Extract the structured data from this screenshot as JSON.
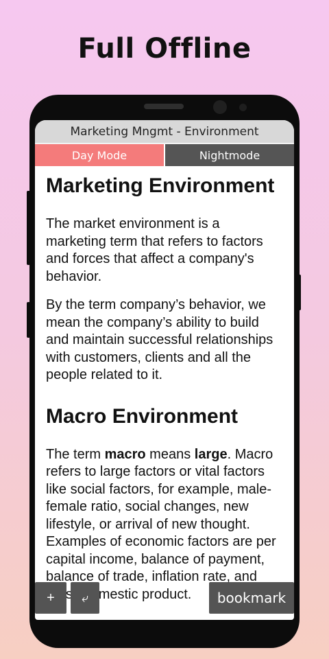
{
  "promo": {
    "title": "Full Offline"
  },
  "app": {
    "title": "Marketing Mngmt - Environment",
    "modes": {
      "day": "Day Mode",
      "night": "Nightmode"
    }
  },
  "content": {
    "heading1": "Marketing Environment",
    "para1": "The market environment is a marketing term that refers to factors and forces that affect a company's behavior.",
    "para2": "By the term company’s behavior, we mean the company’s ability to build and maintain successful relationships with customers, clients and all the people related to it.",
    "heading2": "Macro Environment",
    "para3": {
      "t1": "The term ",
      "b1": "macro",
      "t2": " means ",
      "b2": "large",
      "t3": ". Macro refers to large factors or vital factors like social factors, for example, male-female ratio, social changes, new lifestyle, or arrival of new thought. Examples of economic factors are per capital income, balance of payment, balance of trade, inflation rate, and gross domestic product."
    }
  },
  "buttons": {
    "plus": "+",
    "wrap": "⤶",
    "bookmark": "bookmark"
  },
  "colors": {
    "day_mode": "#f47b7b",
    "night_mode": "#555555",
    "fab": "#545454"
  }
}
